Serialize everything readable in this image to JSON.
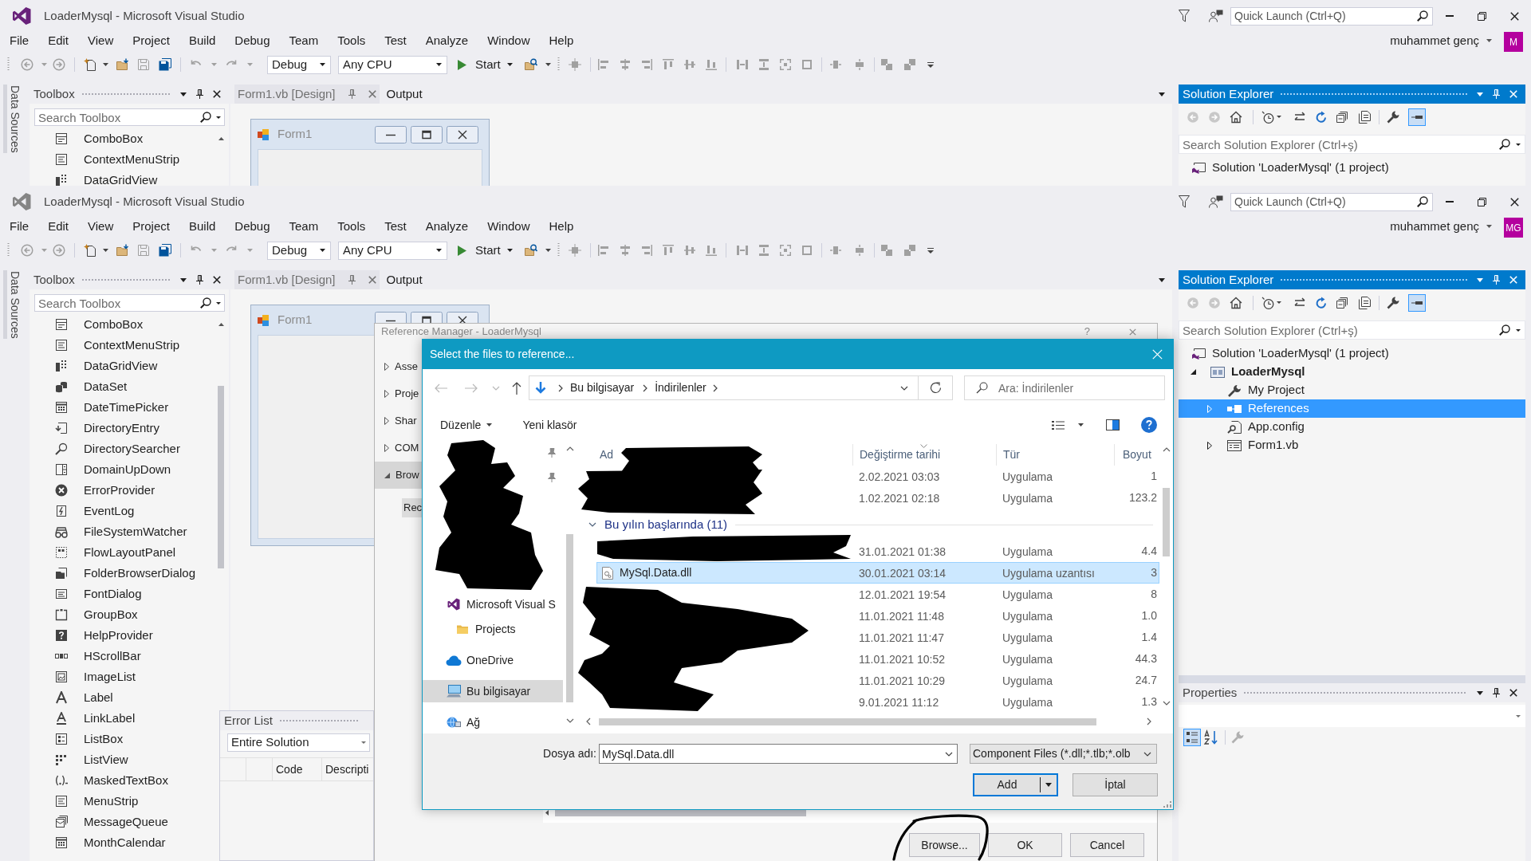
{
  "windows": [
    {
      "title": "LoaderMysql - Microsoft Visual Studio",
      "active": true,
      "quick_launch": {
        "placeholder": "Quick Launch (Ctrl+Q)"
      },
      "menu": [
        "File",
        "Edit",
        "View",
        "Project",
        "Build",
        "Debug",
        "Team",
        "Tools",
        "Test",
        "Analyze",
        "Window",
        "Help"
      ],
      "user": {
        "name": "muhammet genç",
        "initials": "M"
      },
      "toolbar": {
        "configuration": "Debug",
        "platform": "Any CPU",
        "start": "Start"
      },
      "side_tab": "Data Sources",
      "toolbox": {
        "title": "Toolbox",
        "focused": false,
        "search": {
          "placeholder": "Search Toolbox"
        },
        "items": [
          "ComboBox",
          "ContextMenuStrip",
          "DataGridView"
        ]
      },
      "tabs": [
        {
          "label": "Form1.vb [Design]",
          "selected": true
        },
        {
          "label": "Output",
          "selected": false
        }
      ],
      "designer": {
        "form_title": "Form1"
      },
      "solution_explorer": {
        "title": "Solution Explorer",
        "focused": true,
        "preview_on": true,
        "search": {
          "placeholder": "Search Solution Explorer (Ctrl+ş)"
        },
        "tree": [
          {
            "label": "Solution 'LoaderMysql' (1 project)",
            "kind": "solution",
            "selected": false
          }
        ]
      }
    },
    {
      "title": "LoaderMysql - Microsoft Visual Studio",
      "active": false,
      "quick_launch": {
        "placeholder": "Quick Launch (Ctrl+Q)"
      },
      "menu": [
        "File",
        "Edit",
        "View",
        "Project",
        "Build",
        "Debug",
        "Team",
        "Tools",
        "Test",
        "Analyze",
        "Window",
        "Help"
      ],
      "user": {
        "name": "muhammet genç",
        "initials": "MG"
      },
      "toolbar": {
        "configuration": "Debug",
        "platform": "Any CPU",
        "start": "Start"
      },
      "side_tab": "Data Sources",
      "toolbox": {
        "title": "Toolbox",
        "focused": false,
        "search": {
          "placeholder": "Search Toolbox"
        },
        "items": [
          "ComboBox",
          "ContextMenuStrip",
          "DataGridView",
          "DataSet",
          "DateTimePicker",
          "DirectoryEntry",
          "DirectorySearcher",
          "DomainUpDown",
          "ErrorProvider",
          "EventLog",
          "FileSystemWatcher",
          "FlowLayoutPanel",
          "FolderBrowserDialog",
          "FontDialog",
          "GroupBox",
          "HelpProvider",
          "HScrollBar",
          "ImageList",
          "Label",
          "LinkLabel",
          "ListBox",
          "ListView",
          "MaskedTextBox",
          "MenuStrip",
          "MessageQueue",
          "MonthCalendar"
        ]
      },
      "tabs": [
        {
          "label": "Form1.vb [Design]",
          "selected": true
        },
        {
          "label": "Output",
          "selected": false
        }
      ],
      "designer": {
        "form_title": "Form1"
      },
      "solution_explorer": {
        "title": "Solution Explorer",
        "focused": true,
        "preview_on": true,
        "search": {
          "placeholder": "Search Solution Explorer (Ctrl+ş)"
        },
        "tree": [
          {
            "label": "Solution 'LoaderMysql' (1 project)",
            "kind": "solution",
            "selected": false,
            "children": [
              {
                "label": "LoaderMysql",
                "kind": "project",
                "expanded": true,
                "selected": false,
                "children": [
                  {
                    "label": "My Project",
                    "kind": "settings",
                    "selected": false
                  },
                  {
                    "label": "References",
                    "kind": "references",
                    "expanded": false,
                    "selected": true
                  },
                  {
                    "label": "App.config",
                    "kind": "config",
                    "selected": false
                  },
                  {
                    "label": "Form1.vb",
                    "kind": "form",
                    "expanded": false,
                    "selected": false
                  }
                ]
              }
            ]
          }
        ]
      },
      "properties": {
        "title": "Properties",
        "focused": false,
        "categorized": true
      },
      "error_list": {
        "title": "Error List",
        "focused": false,
        "scope": "Entire Solution",
        "columns": [
          "Code",
          "Descripti"
        ]
      },
      "reference_manager": {
        "title": "Reference Manager - LoaderMysql",
        "help_button": "?",
        "nav": [
          {
            "label": "Asse",
            "expanded": false,
            "selected": false
          },
          {
            "label": "Proje",
            "expanded": false,
            "selected": false
          },
          {
            "label": "Shar",
            "expanded": false,
            "selected": false
          },
          {
            "label": "COM",
            "expanded": false,
            "selected": false
          },
          {
            "label": "Brow",
            "expanded": true,
            "selected": true,
            "children": [
              {
                "label": "Rec",
                "selected": true
              }
            ]
          }
        ],
        "buttons": [
          "Browse...",
          "OK",
          "Cancel"
        ]
      },
      "file_dialog": {
        "title": "Select the files to reference...",
        "path": [
          "Bu bilgisayar",
          "İndirilenler"
        ],
        "search": {
          "placeholder": "Ara: İndirilenler"
        },
        "commands": [
          {
            "label": "Düzenle",
            "kind": "menu"
          },
          {
            "label": "Yeni klasör",
            "kind": "plain"
          }
        ],
        "nav": [
          {
            "pinned": true
          },
          {
            "pinned": true
          },
          {
            "label": "Microsoft Visual S",
            "kind": "app",
            "selected": false,
            "children": [
              {
                "label": "Projects",
                "kind": "folder",
                "selected": false
              }
            ]
          },
          {
            "label": "OneDrive",
            "kind": "cloud",
            "selected": false
          },
          {
            "label": "Bu bilgisayar",
            "kind": "computer",
            "selected": true
          },
          {
            "label": "Ağ",
            "kind": "network",
            "selected": false
          }
        ],
        "columns": [
          {
            "label": "Ad",
            "sorted": false
          },
          {
            "label": "Değiştirme tarihi",
            "sorted": true
          },
          {
            "label": "Tür",
            "sorted": false
          },
          {
            "label": "Boyut",
            "sorted": false
          }
        ],
        "groups": [
          {
            "rows": [
              {
                "date": "2.02.2021 03:03",
                "type": "Uygulama",
                "size": "1",
                "selected": false
              },
              {
                "date": "1.02.2021 02:18",
                "type": "Uygulama",
                "size": "123.2",
                "selected": false
              }
            ]
          },
          {
            "title": "Bu yılın başlarında (11)",
            "expanded": true,
            "rows": [
              {
                "date": "31.01.2021 01:38",
                "type": "Uygulama",
                "size": "4.4",
                "selected": false
              },
              {
                "name": "MySql.Data.dll",
                "kind": "dll",
                "date": "30.01.2021 03:14",
                "type": "Uygulama uzantısı",
                "size": "3",
                "selected": true
              },
              {
                "date": "12.01.2021 19:54",
                "type": "Uygulama",
                "size": "8",
                "selected": false
              },
              {
                "date": "11.01.2021 11:48",
                "type": "Uygulama",
                "size": "1.0",
                "selected": false
              },
              {
                "date": "11.01.2021 11:47",
                "type": "Uygulama",
                "size": "1.4",
                "selected": false
              },
              {
                "date": "11.01.2021 10:52",
                "type": "Uygulama",
                "size": "44.3",
                "selected": false
              },
              {
                "date": "11.01.2021 10:29",
                "type": "Uygulama",
                "size": "24.7",
                "selected": false
              },
              {
                "date": "9.01.2021 11:12",
                "type": "Uygulama",
                "size": "1.3",
                "selected": false
              }
            ]
          }
        ],
        "file_name": {
          "label": "Dosya adı:",
          "value": "MySql.Data.dll"
        },
        "filter": "Component Files (*.dll;*.tlb;*.olb",
        "buttons": [
          {
            "label": "Add",
            "kind": "split",
            "default": true
          },
          {
            "label": "İptal",
            "kind": "plain",
            "default": false
          }
        ]
      }
    }
  ]
}
